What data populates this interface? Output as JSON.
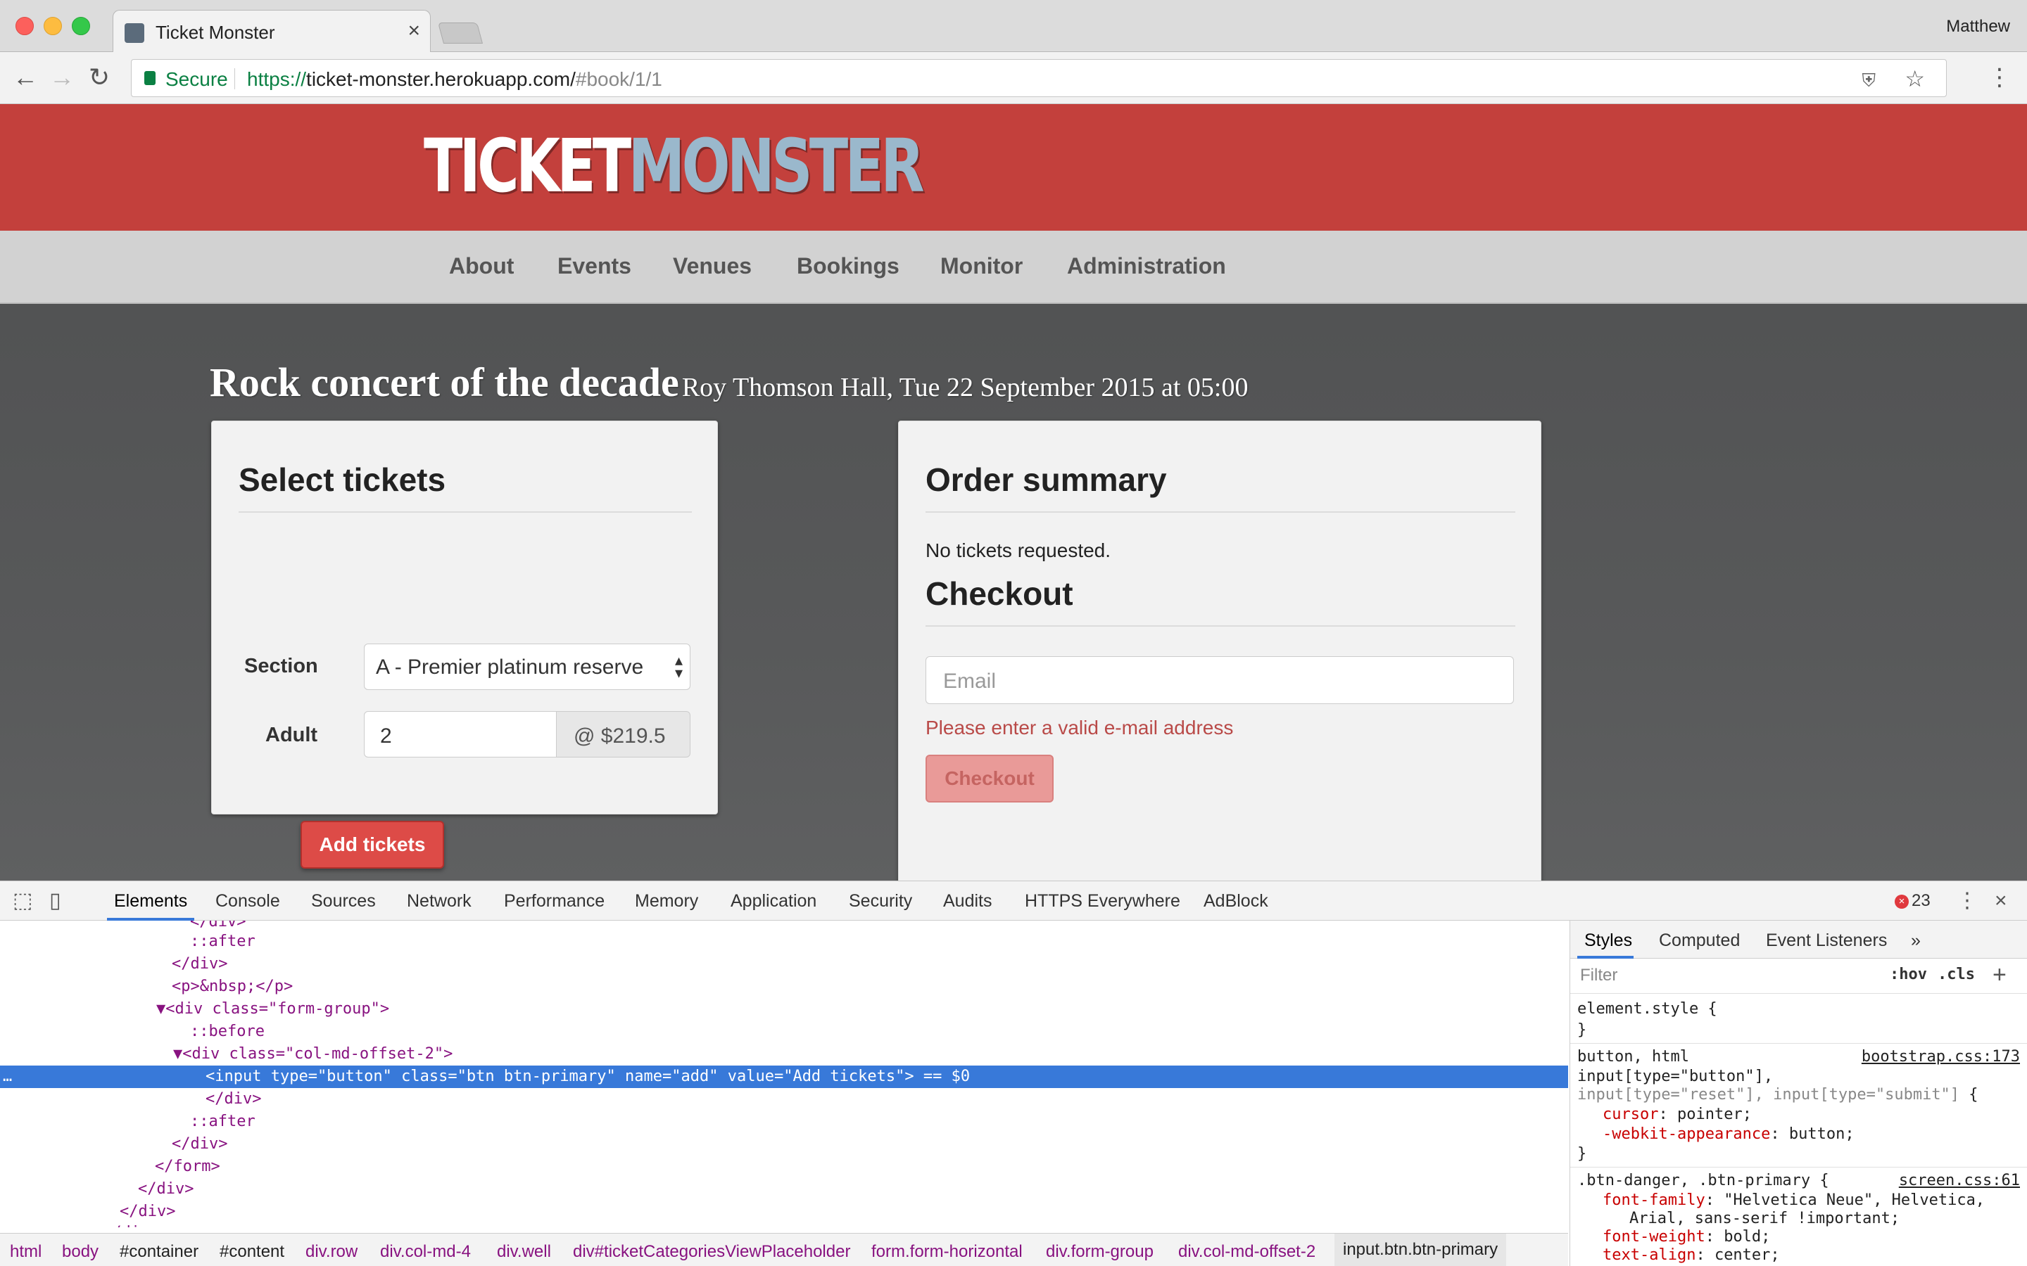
{
  "browser": {
    "tab_title": "Ticket Monster",
    "profile": "Matthew",
    "secure_label": "Secure",
    "url_scheme": "https://",
    "url_host": "ticket-monster.herokuapp.com/",
    "url_path": "#book/1/1"
  },
  "site": {
    "logo_part1": "TICKET",
    "logo_part2": "MONSTER",
    "nav": [
      "About",
      "Events",
      "Venues",
      "Bookings",
      "Monitor",
      "Administration"
    ]
  },
  "event": {
    "title": "Rock concert of the decade",
    "subtitle": "Roy Thomson Hall, Tue 22 September 2015 at 05:00"
  },
  "select_tickets": {
    "heading": "Select tickets",
    "section_label": "Section",
    "section_value": "A - Premier platinum reserve",
    "adult_label": "Adult",
    "adult_qty": "2",
    "adult_price": "@ $219.5",
    "add_button": "Add tickets"
  },
  "order_summary": {
    "heading": "Order summary",
    "empty_text": "No tickets requested.",
    "checkout_heading": "Checkout",
    "email_placeholder": "Email",
    "email_error": "Please enter a valid e-mail address",
    "checkout_button": "Checkout"
  },
  "devtools": {
    "tabs": [
      "Elements",
      "Console",
      "Sources",
      "Network",
      "Performance",
      "Memory",
      "Application",
      "Security",
      "Audits",
      "HTTPS Everywhere",
      "AdBlock"
    ],
    "error_count": "23",
    "dom_lines": [
      "</div>",
      "::after",
      "</div>",
      "<p>&nbsp;</p>",
      "▼<div class=\"form-group\">",
      "::before",
      "▼<div class=\"col-md-offset-2\">",
      "<input type=\"button\" class=\"btn btn-primary\" name=\"add\" value=\"Add tickets\"> == $0",
      "</div>",
      "::after",
      "</div>",
      "</form>",
      "</div>",
      "</div>",
      "</div>"
    ],
    "styles_tabs": [
      "Styles",
      "Computed",
      "Event Listeners",
      "»"
    ],
    "filter_placeholder": "Filter",
    "hov": ":hov",
    "cls": ".cls",
    "css": {
      "element_style": "element.style {",
      "close": "}",
      "rule1_sel": "button, html",
      "rule1_sel2": "input[type=\"button\"],",
      "rule1_sel3_dim": "input[type=\"reset\"], input[type=\"submit\"]",
      "rule1_sel3_tail": " {",
      "rule1_src": "bootstrap.css:173",
      "rule1_p1_name": "cursor",
      "rule1_p1_val": ": pointer;",
      "rule1_p2_name": "-webkit-appearance",
      "rule1_p2_val": ": button;",
      "rule2_sel": ".btn-danger, .btn-primary {",
      "rule2_src": "screen.css:61",
      "rule2_p1_name": "font-family",
      "rule2_p1_val": ": \"Helvetica Neue\", Helvetica,",
      "rule2_p1_cont": "Arial, sans-serif !important;",
      "rule2_p2_name": "font-weight",
      "rule2_p2_val": ": bold;",
      "rule2_p3_name": "text-align",
      "rule2_p3_val": ": center;"
    },
    "breadcrumb": [
      "html",
      "body",
      "#container",
      "#content",
      "div.row",
      "div.col-md-4",
      "div.well",
      "div#ticketCategoriesViewPlaceholder",
      "form.form-horizontal",
      "div.form-group",
      "div.col-md-offset-2",
      "input.btn.btn-primary"
    ]
  }
}
